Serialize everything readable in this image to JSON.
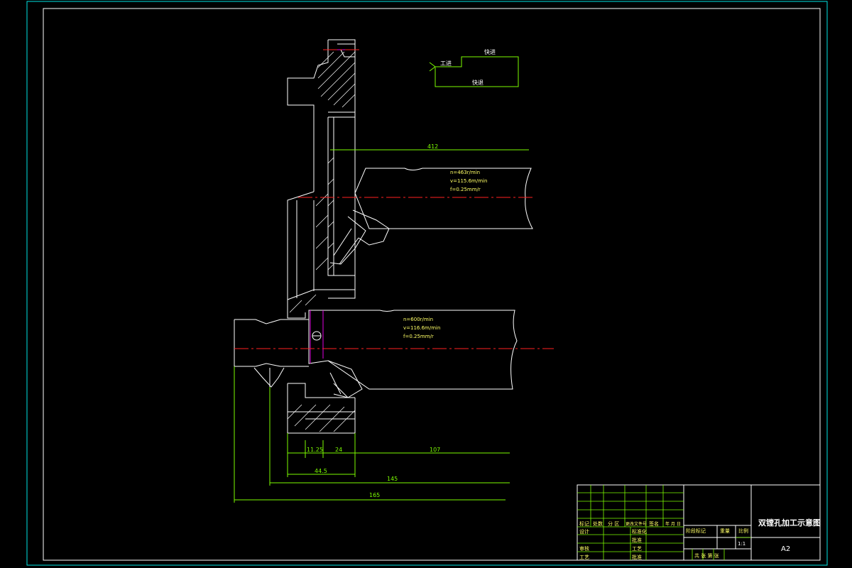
{
  "drawing": {
    "title": "双镗孔加工示意图",
    "sheet_size": "A2",
    "scale": "1:1"
  },
  "process_note": {
    "work_feed": "工进 ",
    "rapid_forward": "快进 ",
    "rapid_return": "快退 "
  },
  "cutting_params": {
    "upper": [
      "n=463r/min",
      "v=115.6m/min",
      "f=0.25mm/r"
    ],
    "lower": [
      "n=600r/min",
      "v=116.6m/min",
      "f=0.25mm/r"
    ]
  },
  "dimensions": {
    "d412": "412",
    "d1125": "11.25",
    "d24": "24",
    "d107": "107",
    "d445": "44.5",
    "d145": "145",
    "d165": "165"
  },
  "title_block": {
    "mark": "标记",
    "count": "处数",
    "zone": "分 区",
    "change_doc": "更改文件号",
    "sign": "签名",
    "date": "年 月 日",
    "design": "设计",
    "standardize": "标准化",
    "review": "审核",
    "craft": "工艺",
    "approve": "批准",
    "process": "工艺",
    "stage_mark": "阶段标记",
    "weight": "重量",
    "scale_label": "比例",
    "sheets": "共  张  第  张"
  }
}
